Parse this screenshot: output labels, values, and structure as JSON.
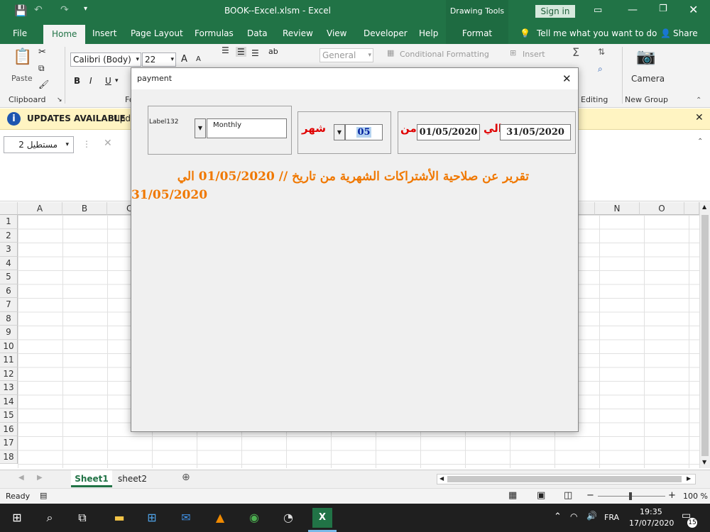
{
  "titlebar": {
    "doc_title": "BOOK--Excel.xlsm  -  Excel",
    "drawing_tools": "Drawing Tools",
    "sign_in": "Sign in"
  },
  "tabs": {
    "file": "File",
    "home": "Home",
    "insert": "Insert",
    "page_layout": "Page Layout",
    "formulas": "Formulas",
    "data": "Data",
    "review": "Review",
    "view": "View",
    "developer": "Developer",
    "help": "Help",
    "format": "Format",
    "tell_me": "Tell me what you want to do",
    "share": "Share"
  },
  "ribbon": {
    "paste": "Paste",
    "clipboard": "Clipboard",
    "font_name": "Calibri (Body)",
    "font_size": "22",
    "number_format": "General",
    "conditional_formatting": "Conditional Formatting",
    "insert": "Insert",
    "editing": "Editing",
    "camera": "Camera",
    "new_group": "New Group",
    "bold": "B",
    "italic": "I",
    "underline": "U",
    "grow": "A",
    "shrink": "A",
    "fo_cut": "Fo"
  },
  "infobar": {
    "title": "UPDATES AVAILABLE",
    "text": "Upda"
  },
  "formula_bar": {
    "name_box": "مستطيل 2"
  },
  "grid": {
    "columns": [
      "A",
      "B",
      "C",
      "N",
      "O"
    ],
    "rows": [
      "1",
      "2",
      "3",
      "4",
      "5",
      "6",
      "7",
      "8",
      "9",
      "10",
      "11",
      "12",
      "13",
      "14",
      "15",
      "16",
      "17",
      "18"
    ]
  },
  "sheets": {
    "tabs": [
      "Sheet1",
      "sheet2"
    ],
    "active": "Sheet1"
  },
  "status": {
    "ready": "Ready",
    "zoom": "100 %"
  },
  "taskbar": {
    "lang": "FRA",
    "time": "19:35",
    "date": "17/07/2020",
    "notif": "15"
  },
  "dialog": {
    "title": "payment",
    "label132": "Label132",
    "period_value": "Monthly",
    "month_label": "شهر",
    "month_value": "05",
    "from_label": "من",
    "from_date": "01/05/2020",
    "to_label": "الي",
    "to_date": "31/05/2020",
    "report_line1": "تقرير عن صلاحية الأشتراكات الشهرية من تاريخ //  01/05/2020 الي",
    "report_line2": "31/05/2020"
  },
  "colors": {
    "excel_green": "#217346",
    "red": "#e00000",
    "orange": "#f07800"
  }
}
